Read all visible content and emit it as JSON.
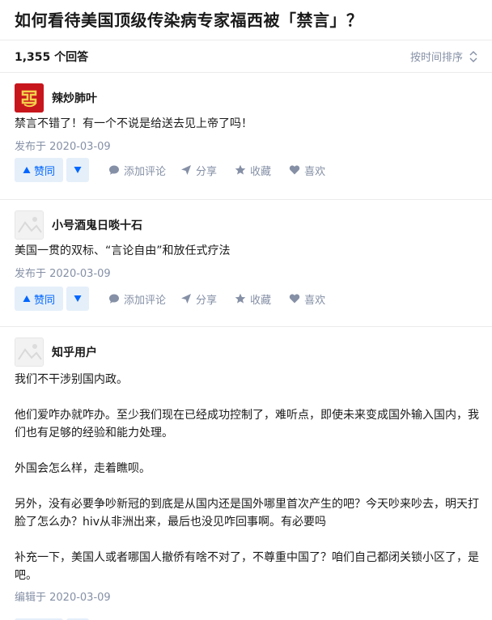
{
  "question": {
    "title": "如何看待美国顶级传染病专家福西被「禁言」？"
  },
  "list_header": {
    "answer_count": "1,355 个回答",
    "sort_label": "按时间排序"
  },
  "actions": {
    "upvote": "赞同",
    "comment": "添加评论",
    "share": "分享",
    "collect": "收藏",
    "like": "喜欢"
  },
  "colors": {
    "accent": "#0066ff",
    "vote_bg": "#e5effa",
    "meta": "#8590a6"
  },
  "answers": [
    {
      "author": "辣炒肺叶",
      "content": [
        "禁言不错了！有一个不说是给送去见上帝了吗！"
      ],
      "time": "发布于 2020-03-09"
    },
    {
      "author": "小号酒鬼日啖十石",
      "content": [
        "美国一贯的双标、“言论自由”和放任式疗法"
      ],
      "time": "发布于 2020-03-09"
    },
    {
      "author": "知乎用户",
      "content": [
        "我们不干涉别国内政。",
        "他们爱咋办就咋办。至少我们现在已经成功控制了，难听点，即使未来变成国外输入国内，我们也有足够的经验和能力处理。",
        "外国会怎么样，走着瞧呗。",
        "另外，没有必要争吵新冠的到底是从国内还是国外哪里首次产生的吧？今天吵来吵去，明天打脸了怎么办？hiv从非洲出来，最后也没见咋回事啊。有必要吗",
        "补充一下，美国人或者哪国人撤侨有啥不对了，不尊重中国了？咱们自己都闭关锁小区了，是吧。"
      ],
      "time": "编辑于 2020-03-09"
    }
  ]
}
